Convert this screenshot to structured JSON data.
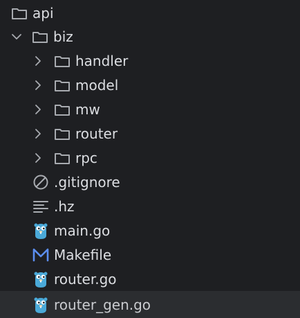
{
  "tree": {
    "items": [
      {
        "label": "api",
        "kind": "folder",
        "depth": 0,
        "expanded": true,
        "icon": "folder-icon"
      },
      {
        "label": "biz",
        "kind": "folder",
        "depth": 1,
        "expanded": true,
        "icon": "folder-icon"
      },
      {
        "label": "handler",
        "kind": "folder",
        "depth": 2,
        "expanded": false,
        "icon": "folder-icon"
      },
      {
        "label": "model",
        "kind": "folder",
        "depth": 2,
        "expanded": false,
        "icon": "folder-icon"
      },
      {
        "label": "mw",
        "kind": "folder",
        "depth": 2,
        "expanded": false,
        "icon": "folder-icon"
      },
      {
        "label": "router",
        "kind": "folder",
        "depth": 2,
        "expanded": false,
        "icon": "folder-icon"
      },
      {
        "label": "rpc",
        "kind": "folder",
        "depth": 2,
        "expanded": false,
        "icon": "folder-icon"
      },
      {
        "label": ".gitignore",
        "kind": "file",
        "depth": 1,
        "icon": "ignore-file-icon"
      },
      {
        "label": ".hz",
        "kind": "file",
        "depth": 1,
        "icon": "text-file-icon"
      },
      {
        "label": "main.go",
        "kind": "file",
        "depth": 1,
        "icon": "go-gopher-icon"
      },
      {
        "label": "Makefile",
        "kind": "file",
        "depth": 1,
        "icon": "makefile-icon"
      },
      {
        "label": "router.go",
        "kind": "file",
        "depth": 1,
        "icon": "go-gopher-icon"
      },
      {
        "label": "router_gen.go",
        "kind": "file",
        "depth": 1,
        "icon": "go-gopher-icon",
        "selected": true
      }
    ]
  },
  "colors": {
    "background": "#1e1f22",
    "selected_row": "#2b2d30",
    "text": "#dcdee2",
    "icon_gray": "#a8abb0",
    "gopher_blue": "#4aa9d8",
    "makefile_blue": "#5b8ef0"
  }
}
